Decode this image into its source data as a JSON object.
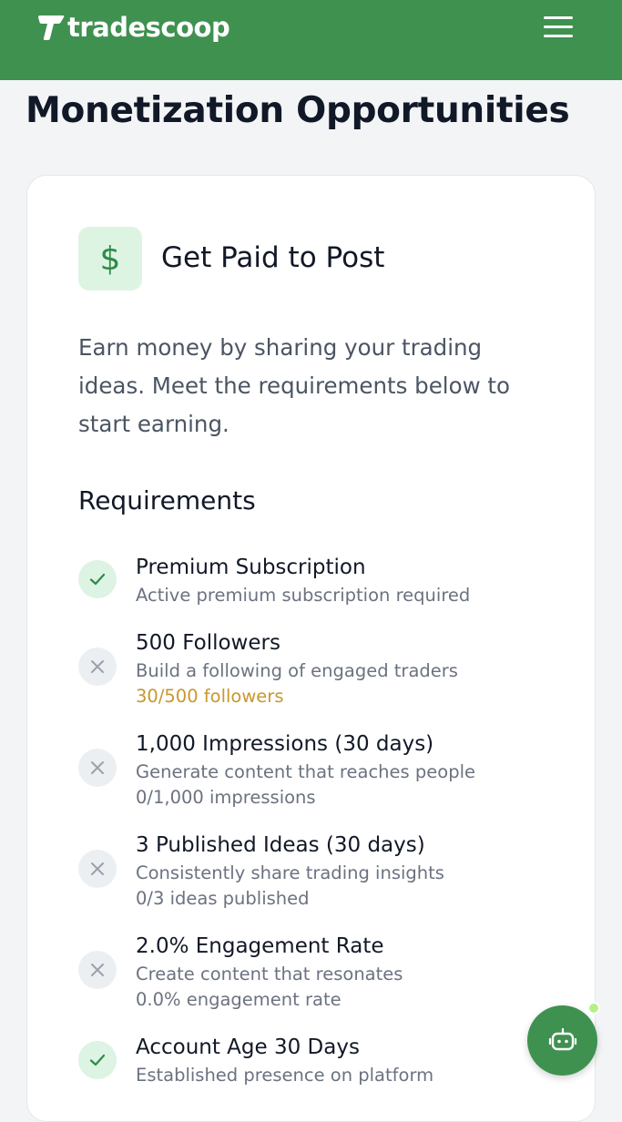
{
  "header": {
    "logo_text": "tradescoop",
    "brand_color": "#3f9150",
    "menu_icon": "hamburger-menu-icon"
  },
  "page": {
    "title": "Monetization Opportunities"
  },
  "card": {
    "icon": "dollar-icon",
    "icon_glyph": "$",
    "title": "Get Paid to Post",
    "description": "Earn money by sharing your trading ideas. Meet the requirements below to start earning.",
    "requirements_heading": "Requirements",
    "requirements": [
      {
        "title": "Premium Subscription",
        "subtitle": "Active premium subscription required",
        "progress": "",
        "met": true
      },
      {
        "title": "500 Followers",
        "subtitle": "Build a following of engaged traders",
        "progress": "30/500 followers",
        "progress_color": "#c9972c",
        "met": false
      },
      {
        "title": "1,000 Impressions (30 days)",
        "subtitle": "Generate content that reaches people",
        "progress": "0/1,000 impressions",
        "progress_color": "#6b7280",
        "met": false
      },
      {
        "title": "3 Published Ideas (30 days)",
        "subtitle": "Consistently share trading insights",
        "progress": "0/3 ideas published",
        "progress_color": "#6b7280",
        "met": false
      },
      {
        "title": "2.0% Engagement Rate",
        "subtitle": "Create content that resonates",
        "progress": "0.0% engagement rate",
        "progress_color": "#6b7280",
        "met": false
      },
      {
        "title": "Account Age 30 Days",
        "subtitle": "Established presence on platform",
        "progress": "",
        "met": true
      }
    ]
  },
  "fab": {
    "icon": "bot-icon",
    "status_color": "#b6f08a"
  },
  "colors": {
    "met_check": "#2e8b46",
    "unmet_x": "#9aa1ab"
  }
}
